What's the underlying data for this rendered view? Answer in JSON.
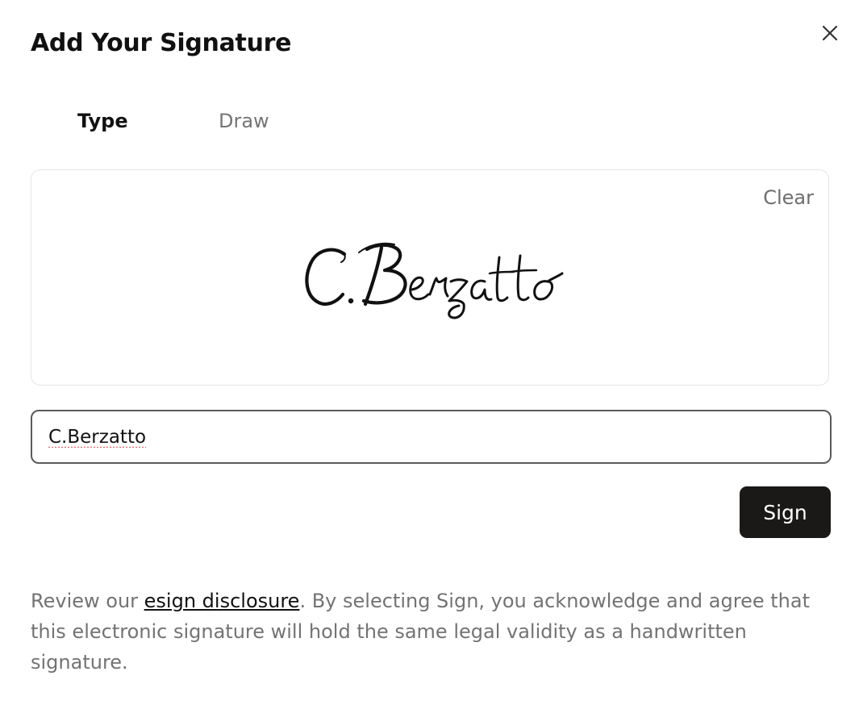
{
  "dialog": {
    "title": "Add Your Signature",
    "close_icon": "close-icon"
  },
  "tabs": [
    {
      "label": "Type",
      "active": true
    },
    {
      "label": "Draw",
      "active": false
    }
  ],
  "preview": {
    "clear_label": "Clear",
    "signature_text": "C.Berzatto"
  },
  "input": {
    "value": "C.Berzatto"
  },
  "actions": {
    "sign_label": "Sign"
  },
  "disclosure": {
    "prefix": "Review our ",
    "link_text": "esign disclosure",
    "suffix": ". By selecting Sign, you acknowledge and agree that this electronic signature will hold the same legal validity as a handwritten signature."
  },
  "colors": {
    "primary_button": "#1b1918",
    "muted_text": "#737373",
    "border": "#e4e4e4"
  }
}
